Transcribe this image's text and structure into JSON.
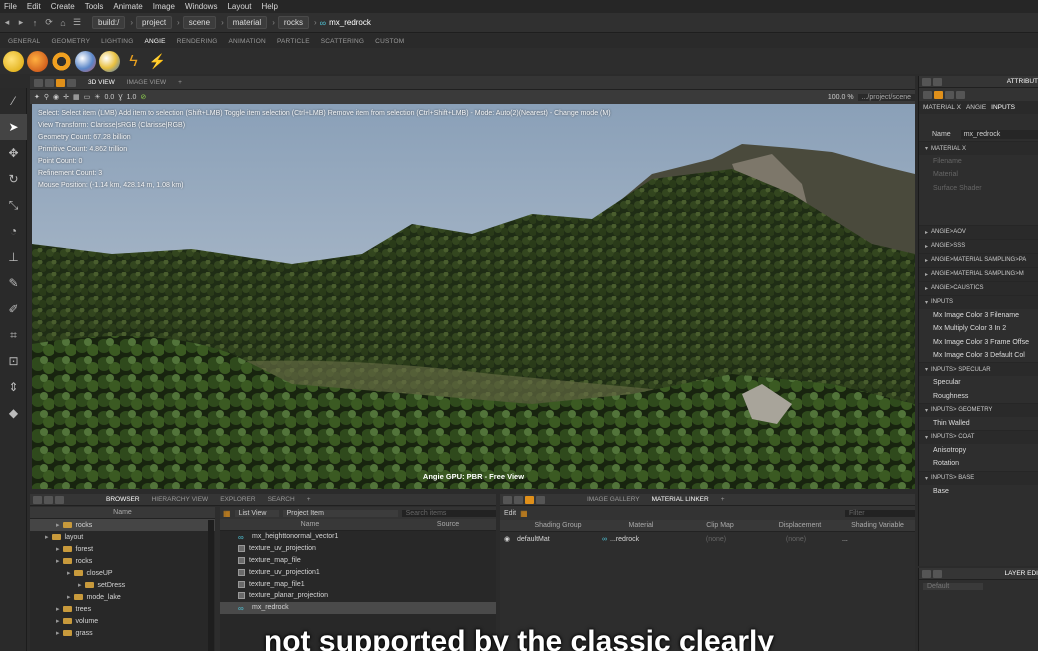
{
  "menu": [
    "File",
    "Edit",
    "Create",
    "Tools",
    "Animate",
    "Image",
    "Windows",
    "Layout",
    "Help"
  ],
  "path": {
    "crumbs": [
      "build:/",
      "project",
      "scene",
      "material",
      "rocks"
    ],
    "current": "mx_redrock"
  },
  "shelf_tabs": [
    "GENERAL",
    "GEOMETRY",
    "LIGHTING",
    "ANGIE",
    "RENDERING",
    "ANIMATION",
    "PARTICLE",
    "SCATTERING",
    "CUSTOM"
  ],
  "shelf_active": "ANGIE",
  "viewport": {
    "tabs": [
      "3D VIEW",
      "IMAGE VIEW"
    ],
    "toolbar": {
      "zoom1": "0.0",
      "zoom2": "1.0",
      "percent": "100.0 %",
      "cam_path": ".../project/scene"
    },
    "info": [
      "Select: Select item (LMB)  Add item to selection (Shift+LMB)  Toggle item selection (Ctrl+LMB)  Remove item from selection (Ctrl+Shift+LMB) - Mode: Auto(2)(Nearest) - Change mode (M)",
      "View Transform: Clarisse|sRGB (Clarisse|RGB)",
      "Geometry Count: 67.28 billion",
      "Primitive Count: 4.862 trillion",
      "Point Count: 0",
      "Refinement Count: 3",
      "Mouse Position: (-1.14 km, 428.14 m, 1.08 km)"
    ],
    "status": "Angie GPU: PBR - Free View"
  },
  "attr": {
    "tabs": [
      "MATERIAL X",
      "ANGIE",
      "INPUTS"
    ],
    "title": "ATTRIBUT",
    "name_label": "Name",
    "name_value": "mx_redrock",
    "sections": [
      {
        "label": "MATERIAL X",
        "rows": [
          "Filename",
          "Material",
          "Surface Shader"
        ],
        "dim": true
      },
      {
        "label": "ANGIE>AOV",
        "rows": []
      },
      {
        "label": "ANGIE>SSS",
        "rows": []
      },
      {
        "label": "ANGIE>MATERIAL SAMPLING>PA",
        "rows": []
      },
      {
        "label": "ANGIE>MATERIAL SAMPLING>M",
        "rows": []
      },
      {
        "label": "ANGIE>CAUSTICS",
        "rows": []
      },
      {
        "label": "INPUTS",
        "rows": [
          "Mx Image Color 3 Filename",
          "Mx Multiply Color 3 In 2",
          "Mx Image Color 3 Frame Offse",
          "Mx Image Color 3 Default Col"
        ]
      },
      {
        "label": "INPUTS> SPECULAR",
        "rows": [
          "Specular",
          "Roughness"
        ]
      },
      {
        "label": "INPUTS> GEOMETRY",
        "rows": [
          "Thin Walled"
        ]
      },
      {
        "label": "INPUTS> COAT",
        "rows": [
          "Anisotropy",
          "Rotation"
        ]
      },
      {
        "label": "INPUTS> BASE",
        "rows": [
          "Base"
        ]
      }
    ]
  },
  "browser": {
    "tabs": [
      "BROWSER",
      "HIERARCHY VIEW",
      "EXPLORER",
      "SEARCH"
    ],
    "name_header": "Name",
    "tree": [
      {
        "label": "rocks",
        "depth": 2,
        "sel": true
      },
      {
        "label": "layout",
        "depth": 1
      },
      {
        "label": "forest",
        "depth": 2
      },
      {
        "label": "rocks",
        "depth": 2
      },
      {
        "label": "closeUP",
        "depth": 3
      },
      {
        "label": "setDress",
        "depth": 4
      },
      {
        "label": "mode_lake",
        "depth": 3
      },
      {
        "label": "trees",
        "depth": 2
      },
      {
        "label": "volume",
        "depth": 2
      },
      {
        "label": "grass",
        "depth": 2
      }
    ],
    "list_view": "List View",
    "project_item": "Project Item",
    "search_placeholder": "Search items",
    "items_headers": [
      "Name",
      "Source"
    ],
    "items": [
      "mx_heighttonormal_vector1",
      "texture_uv_projection",
      "texture_map_file",
      "texture_uv_projection1",
      "texture_map_file1",
      "texture_planar_projection",
      "mx_redrock"
    ]
  },
  "linker": {
    "tabs": [
      "IMAGE GALLERY",
      "MATERIAL LINKER"
    ],
    "edit": "Edit",
    "filter_placeholder": "Filter",
    "headers": [
      "Shading Group",
      "Material",
      "Clip Map",
      "Displacement",
      "Shading Variable"
    ],
    "row": {
      "group": "defaultMat",
      "material": "...redrock",
      "clip": "(none)",
      "disp": "(none)",
      "var": "..."
    }
  },
  "layer_editor": {
    "title": "LAYER EDI",
    "value": "Default"
  },
  "subtitle": "not supported by the classic clearly"
}
